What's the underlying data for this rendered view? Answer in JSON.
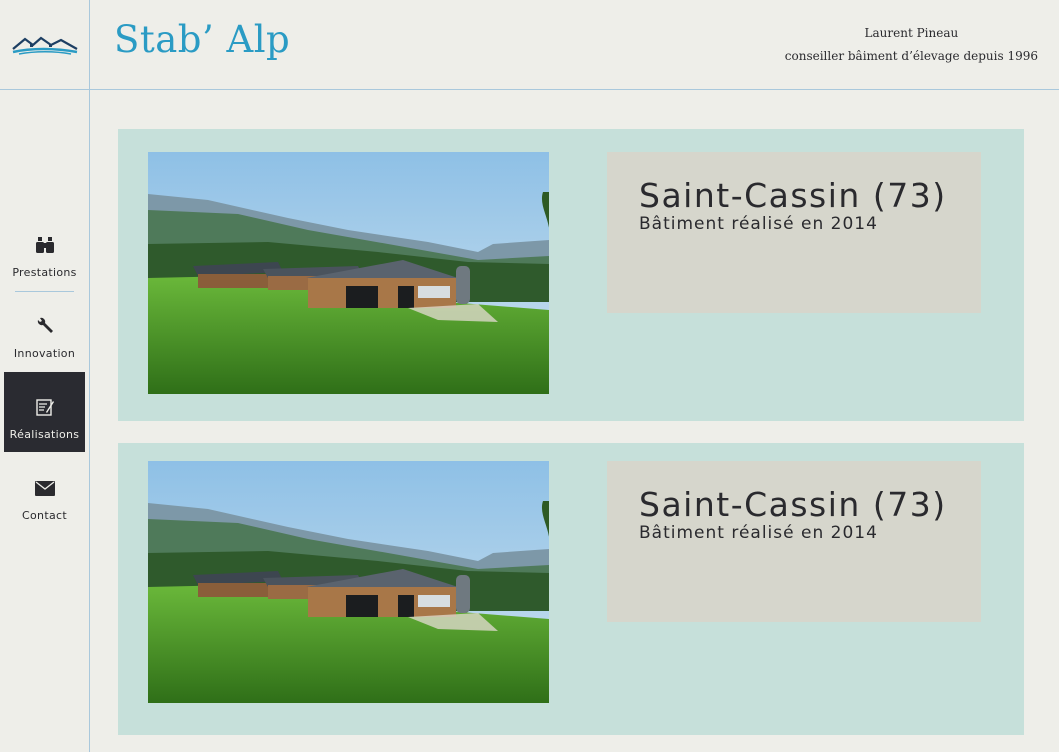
{
  "header": {
    "brand": "Stab’ Alp",
    "owner_name": "Laurent Pineau",
    "owner_tagline": "conseiller bâiment d’élevage depuis 1996",
    "logo_icon": "mountain-logo-icon"
  },
  "colors": {
    "background": "#eeeee9",
    "accent": "#2a9bc4",
    "divider": "#a9c8dc",
    "card_bg": "#c6e0da",
    "infobox_bg": "#d6d6cc",
    "active_nav_bg": "#2a2b31"
  },
  "sidebar": {
    "items": [
      {
        "label": "Prestations",
        "icon": "binoculars-icon",
        "active": false
      },
      {
        "label": "Innovation",
        "icon": "wrench-icon",
        "active": false
      },
      {
        "label": "Réalisations",
        "icon": "blueprint-icon",
        "active": true
      },
      {
        "label": "Contact",
        "icon": "envelope-icon",
        "active": false
      }
    ]
  },
  "projects": [
    {
      "place": "Saint-Cassin (73)",
      "description": "Bâtiment réalisé en 2014",
      "image": "barn-photo"
    },
    {
      "place": "Saint-Cassin (73)",
      "description": "Bâtiment réalisé en 2014",
      "image": "barn-photo"
    }
  ]
}
